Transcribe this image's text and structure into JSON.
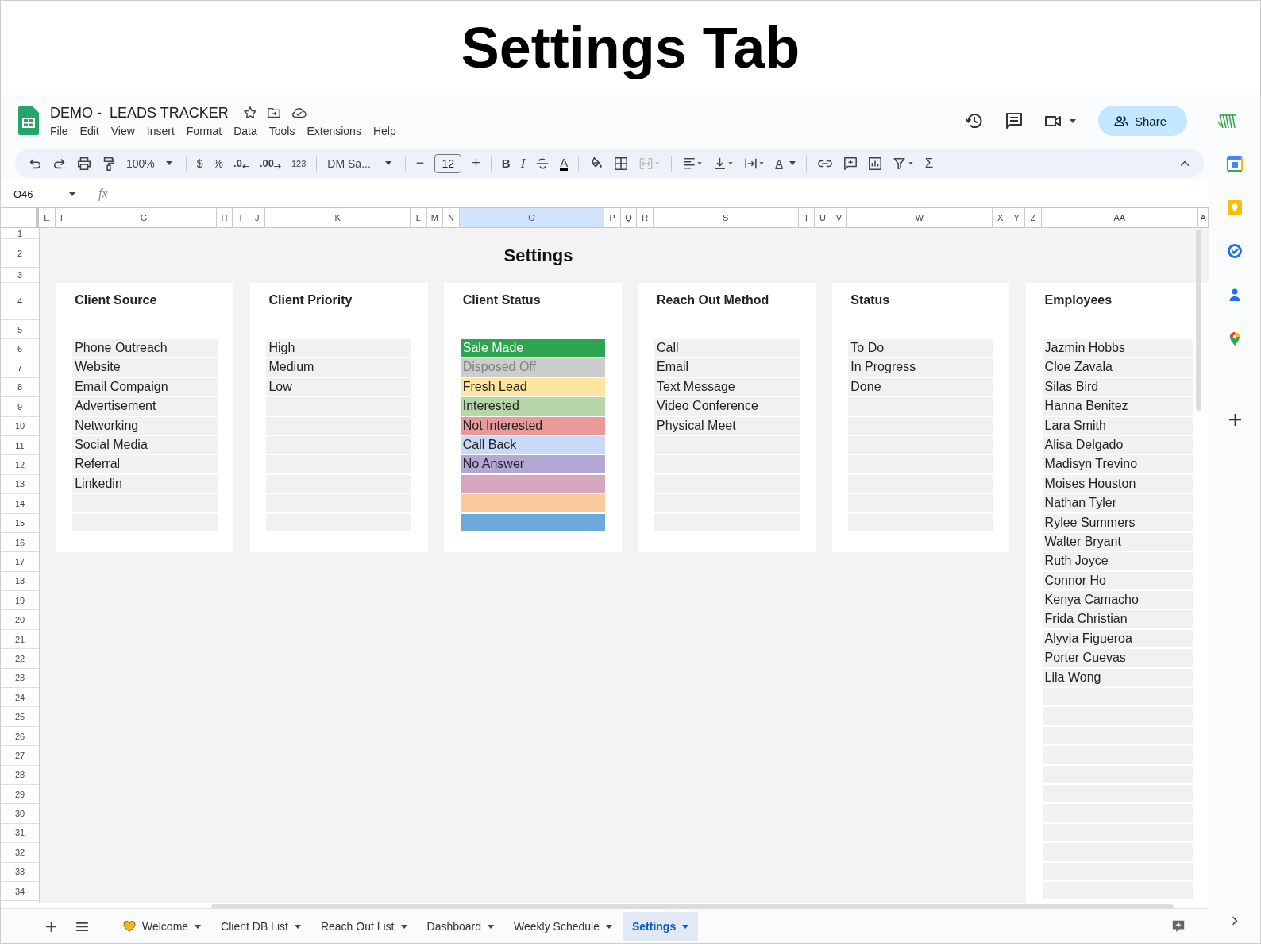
{
  "banner": {
    "title": "Settings Tab"
  },
  "doc": {
    "title": "DEMO -  LEADS TRACKER",
    "menus": [
      "File",
      "Edit",
      "View",
      "Insert",
      "Format",
      "Data",
      "Tools",
      "Extensions",
      "Help"
    ]
  },
  "share": {
    "label": "Share"
  },
  "toolbar": {
    "zoom": "100%",
    "currency": "$",
    "percent": "%",
    "decrease_decimal": ".0",
    "increase_decimal": ".00",
    "number_format": "123",
    "font": "DM Sa...",
    "font_size": "12",
    "minus": "−",
    "plus": "+",
    "bold": "B",
    "italic": "I",
    "text_color": "A",
    "rotate": "A",
    "sum": "Σ"
  },
  "formula_bar": {
    "cell": "O46",
    "fx": "fx"
  },
  "columns": [
    {
      "label": "E",
      "selected": false
    },
    {
      "label": "F",
      "selected": false
    },
    {
      "label": "G",
      "selected": false
    },
    {
      "label": "H",
      "selected": false
    },
    {
      "label": "I",
      "selected": false
    },
    {
      "label": "J",
      "selected": false
    },
    {
      "label": "K",
      "selected": false
    },
    {
      "label": "L",
      "selected": false
    },
    {
      "label": "M",
      "selected": false
    },
    {
      "label": "N",
      "selected": false
    },
    {
      "label": "O",
      "selected": true
    },
    {
      "label": "P",
      "selected": false
    },
    {
      "label": "Q",
      "selected": false
    },
    {
      "label": "R",
      "selected": false
    },
    {
      "label": "S",
      "selected": false
    },
    {
      "label": "T",
      "selected": false
    },
    {
      "label": "U",
      "selected": false
    },
    {
      "label": "V",
      "selected": false
    },
    {
      "label": "W",
      "selected": false
    },
    {
      "label": "X",
      "selected": false
    },
    {
      "label": "Y",
      "selected": false
    },
    {
      "label": "Z",
      "selected": false
    },
    {
      "label": "AA",
      "selected": false
    },
    {
      "label": "A",
      "selected": false
    }
  ],
  "rows": [
    "1",
    "2",
    "3",
    "4",
    "5",
    "6",
    "7",
    "8",
    "9",
    "10",
    "11",
    "12",
    "13",
    "14",
    "15",
    "16",
    "17",
    "18",
    "19",
    "20",
    "21",
    "22",
    "23",
    "24",
    "25",
    "26",
    "27",
    "28",
    "29",
    "30",
    "31",
    "32",
    "33",
    "34"
  ],
  "sheet_title": "Settings",
  "cards": [
    {
      "title": "Client Source",
      "items": [
        {
          "label": "Phone Outreach"
        },
        {
          "label": "Website"
        },
        {
          "label": "Email Compaign"
        },
        {
          "label": "Advertisement"
        },
        {
          "label": "Networking"
        },
        {
          "label": "Social Media"
        },
        {
          "label": "Referral"
        },
        {
          "label": "Linkedin"
        }
      ]
    },
    {
      "title": "Client Priority",
      "items": [
        {
          "label": "High"
        },
        {
          "label": "Medium"
        },
        {
          "label": "Low"
        }
      ]
    },
    {
      "title": "Client Status",
      "items": [
        {
          "label": "Sale Made",
          "color": "#2da44e"
        },
        {
          "label": "Disposed Off",
          "color": "#cccccc"
        },
        {
          "label": "Fresh Lead",
          "color": "#ffe5a0"
        },
        {
          "label": "Interested",
          "color": "#b6d7a8"
        },
        {
          "label": "Not Interested",
          "color": "#ea9999"
        },
        {
          "label": "Call Back",
          "color": "#c9daf8"
        },
        {
          "label": "No Answer",
          "color": "#b4a7d6"
        },
        {
          "color": "#d5a6bd"
        },
        {
          "color": "#f9cb9c"
        },
        {
          "color": "#6fa8dc"
        }
      ]
    },
    {
      "title": "Reach Out Method",
      "items": [
        {
          "label": "Call"
        },
        {
          "label": "Email"
        },
        {
          "label": "Text Message"
        },
        {
          "label": "Video Conference"
        },
        {
          "label": "Physical Meet"
        }
      ]
    },
    {
      "title": "Status",
      "items": [
        {
          "label": "To Do"
        },
        {
          "label": "In Progress"
        },
        {
          "label": "Done"
        }
      ]
    },
    {
      "title": "Employees",
      "items": [
        {
          "label": "Jazmin Hobbs"
        },
        {
          "label": "Cloe Zavala"
        },
        {
          "label": "Silas Bird"
        },
        {
          "label": "Hanna Benitez"
        },
        {
          "label": "Lara Smith"
        },
        {
          "label": "Alisa Delgado"
        },
        {
          "label": "Madisyn Trevino"
        },
        {
          "label": "Moises Houston"
        },
        {
          "label": "Nathan Tyler"
        },
        {
          "label": "Rylee Summers"
        },
        {
          "label": "Walter Bryant"
        },
        {
          "label": "Ruth Joyce"
        },
        {
          "label": "Connor Ho"
        },
        {
          "label": "Kenya Camacho"
        },
        {
          "label": "Frida Christian"
        },
        {
          "label": "Alyvia Figueroa"
        },
        {
          "label": "Porter Cuevas"
        },
        {
          "label": "Lila Wong"
        }
      ]
    }
  ],
  "sheet_tabs": [
    {
      "label": "Welcome",
      "selected": false
    },
    {
      "label": "Client DB List",
      "selected": false
    },
    {
      "label": "Reach Out List",
      "selected": false
    },
    {
      "label": "Dashboard",
      "selected": false
    },
    {
      "label": "Weekly Schedule",
      "selected": false
    },
    {
      "label": "Settings",
      "selected": true
    }
  ]
}
